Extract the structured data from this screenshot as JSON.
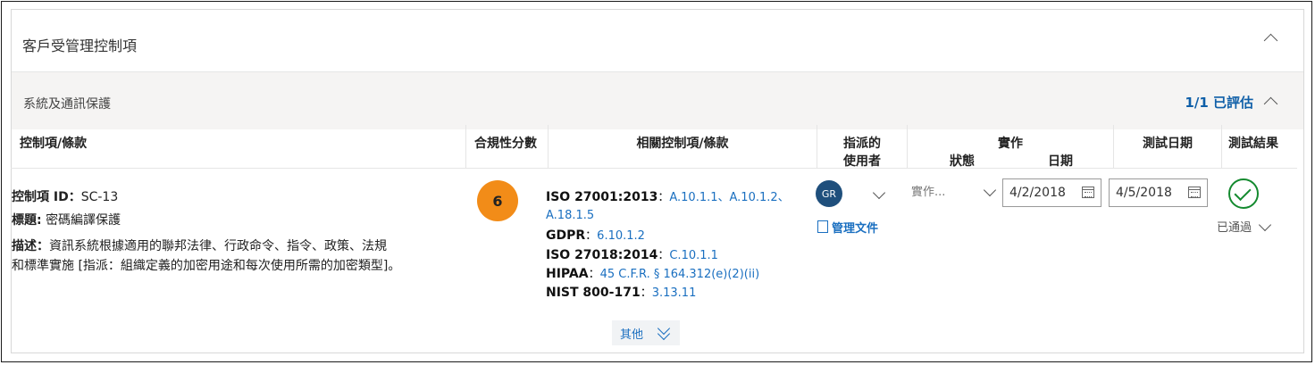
{
  "panel": {
    "title": "客戶受管理控制項"
  },
  "section": {
    "title": "系統及通訊保護",
    "assessed": "1/1 已評估"
  },
  "columns": {
    "control": "控制項/條款",
    "score": "合規性分數",
    "related": "相關控制項/條款",
    "assigned_line1": "指派的",
    "assigned_line2": "使用者",
    "implementation": "實作",
    "status": "狀態",
    "date": "日期",
    "test_date": "測試日期",
    "test_result": "測試結果"
  },
  "row": {
    "control_id_label": "控制項 ID：",
    "control_id": "SC-13",
    "title_label": "標題:",
    "title": "密碼編譯保護",
    "description_label": "描述：",
    "description_line1": "資訊系統根據適用的聯邦法律、行政命令、指令、政策、法規",
    "description_line2": "和標準實施 [指派：組織定義的加密用途和每次使用所需的加密類型]。",
    "score": "6",
    "related": [
      {
        "name": "ISO 27001:2013",
        "sep": "：",
        "links": "A.10.1.1、A.10.1.2、"
      },
      {
        "name": "",
        "sep": "",
        "links": "A.18.1.5"
      },
      {
        "name": "GDPR",
        "sep": "：",
        "links": "6.10.1.2"
      },
      {
        "name": "ISO 27018:2014",
        "sep": "：",
        "links": "C.10.1.1"
      },
      {
        "name": "HIPAA",
        "sep": "：",
        "links": "45 C.F.R. § 164.312(e)(2)(ii)"
      },
      {
        "name": "NIST 800-171",
        "sep": "：",
        "links": "3.13.11"
      }
    ],
    "assigned_user": "GR",
    "manage_docs": "管理文件",
    "implementation_status": "實作...",
    "implementation_date": "4/2/2018",
    "test_date": "4/5/2018",
    "test_result": "已通過"
  },
  "more_label": "其他",
  "colors": {
    "accent": "#1a6fc0",
    "score": "#f28c18",
    "pass": "#148a2f",
    "avatar": "#1f4f7c"
  },
  "icons": [
    "chevron-up-icon",
    "chevron-down-icon",
    "calendar-icon",
    "checkmark-icon",
    "document-icon"
  ]
}
